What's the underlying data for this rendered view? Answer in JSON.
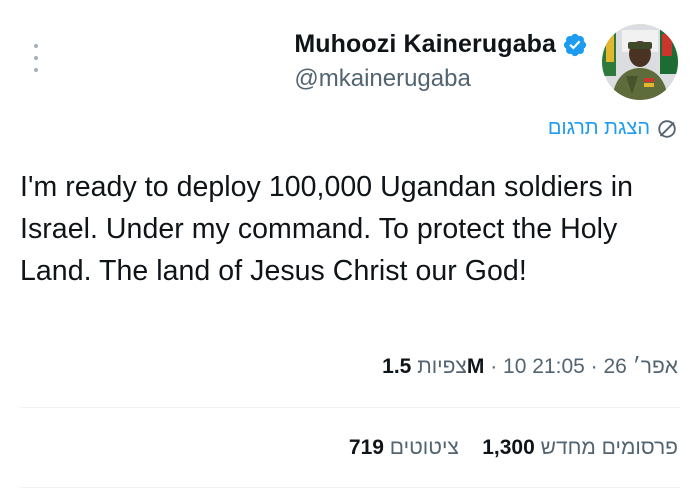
{
  "author": {
    "display_name": "Muhoozi Kainerugaba",
    "handle": "@mkainerugaba",
    "verified_icon": "verified-badge-icon",
    "avatar_icon": "avatar"
  },
  "translate": {
    "label": "הצגת תרגום",
    "icon": "translate-icon"
  },
  "tweet": {
    "text": "I'm ready to deploy 100,000 Ugandan soldiers in Israel. Under my command. To protect the Holy Land. The land of Jesus Christ our God!"
  },
  "meta": {
    "time": "21:05",
    "date": "10 אפר׳ 26",
    "views_count": "1.5M",
    "views_label": "צפיות",
    "separator": "·"
  },
  "stats": {
    "reposts_count": "1,300",
    "reposts_label": "פרסומים מחדש",
    "quotes_count": "719",
    "quotes_label": "ציטוטים"
  },
  "colors": {
    "accent": "#1d9bf0",
    "text_primary": "#0f1419",
    "text_secondary": "#536471",
    "divider": "#eff3f4"
  }
}
